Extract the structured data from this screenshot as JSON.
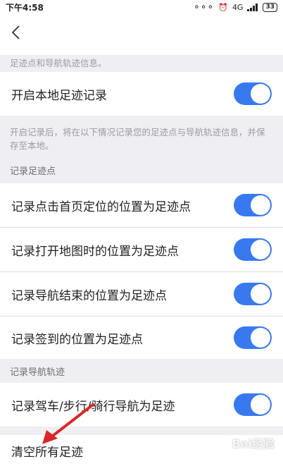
{
  "status_bar": {
    "time": "下午4:58",
    "network": "4G",
    "battery": "33"
  },
  "notes": {
    "top": "足迹点和导航轨迹信息。",
    "local_record": "开启记录后，将在以下情况记录您的足迹点与导航轨迹信息，并保存至本地。"
  },
  "main_toggle": {
    "label": "开启本地足迹记录",
    "on": true
  },
  "sections": {
    "footprint": "记录足迹点",
    "navigation": "记录导航轨迹"
  },
  "footprint_rows": [
    {
      "label": "记录点击首页定位的位置为足迹点",
      "on": true
    },
    {
      "label": "记录打开地图时的位置为足迹点",
      "on": true
    },
    {
      "label": "记录导航结束的位置为足迹点",
      "on": true
    },
    {
      "label": "记录签到的位置为足迹点",
      "on": true
    }
  ],
  "nav_row": {
    "label": "记录驾车/步行/骑行导航为足迹",
    "on": true
  },
  "clear_row": {
    "label": "清空所有足迹"
  },
  "watermark": "Bai经验",
  "colors": {
    "accent": "#3879f0",
    "annotation_arrow": "#d8282a",
    "background": "#efeff3"
  }
}
